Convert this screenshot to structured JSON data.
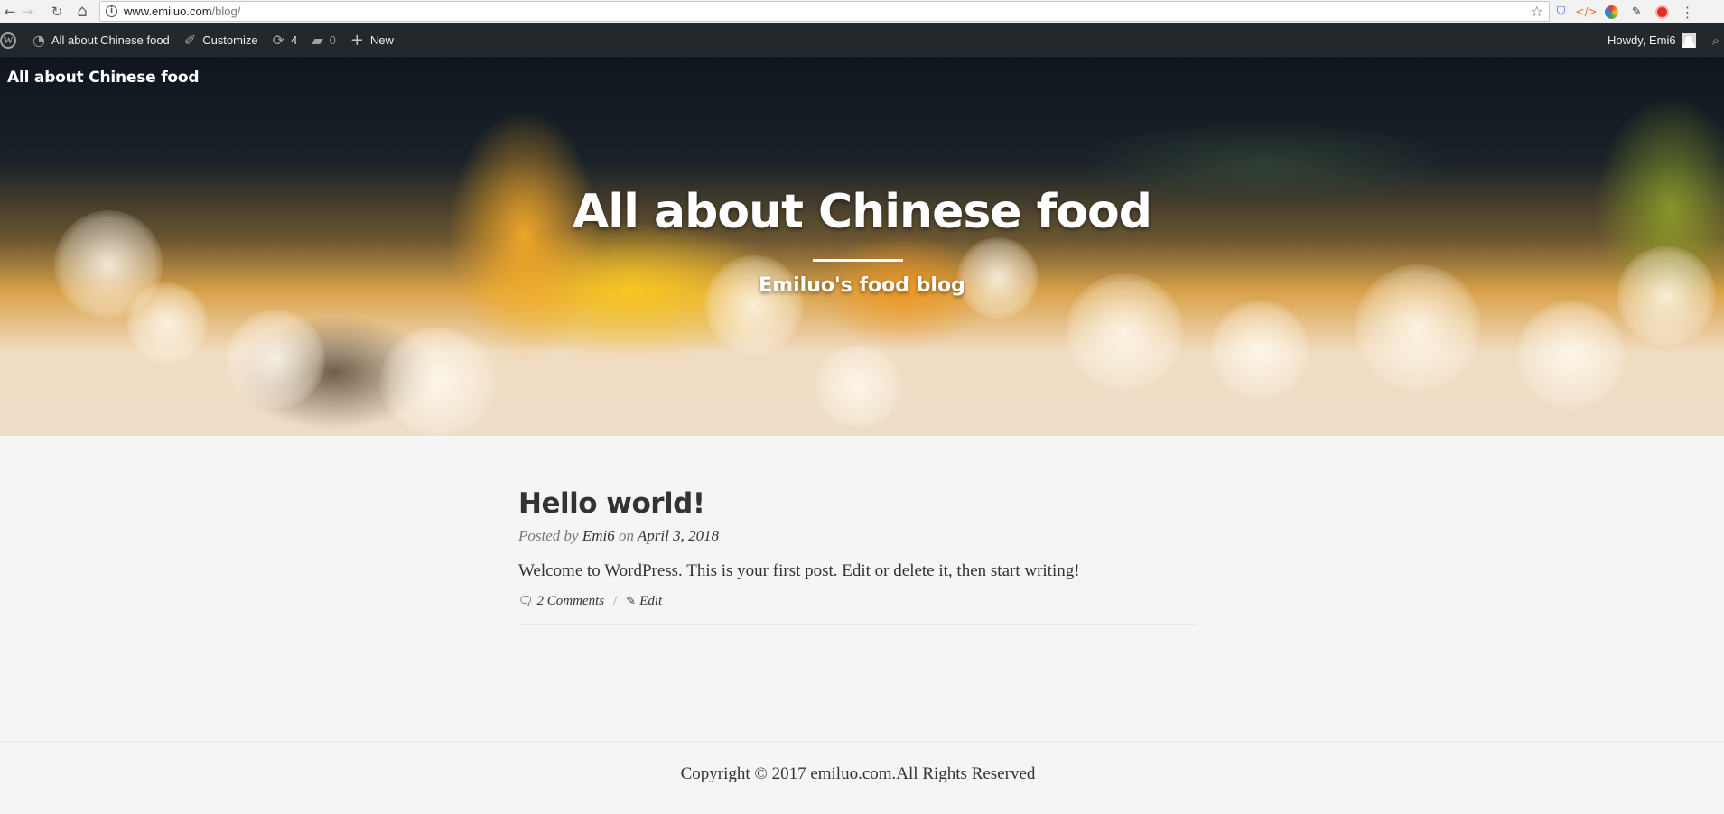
{
  "browser": {
    "back_icon": "←",
    "forward_icon": "→",
    "reload_icon": "↻",
    "home_icon": "⌂",
    "url_host": "www.emiluo.com",
    "url_path": "/blog/",
    "bookmark_icon": "☆",
    "menu_icon": "⋮"
  },
  "admin_bar": {
    "site_name": "All about Chinese food",
    "customize": "Customize",
    "updates_count": "4",
    "comments_count": "0",
    "new_label": "New",
    "howdy": "Howdy, Emi6"
  },
  "hero": {
    "brand": "All about Chinese food",
    "title": "All about Chinese food",
    "subtitle": "Emiluo's food blog"
  },
  "post": {
    "title": "Hello world!",
    "posted_by": "Posted by",
    "author": "Emi6",
    "on": "on",
    "date": "April 3, 2018",
    "excerpt": "Welcome to WordPress. This is your first post. Edit or delete it, then start writing!",
    "comments": "2 Comments",
    "separator": "/",
    "edit": "Edit"
  },
  "footer": {
    "copyright": "Copyright © 2017 emiluo.com.All Rights Reserved"
  },
  "colors": {
    "admin_bar_bg": "#23282d",
    "page_bg": "#f5f5f5",
    "text": "#333333"
  }
}
